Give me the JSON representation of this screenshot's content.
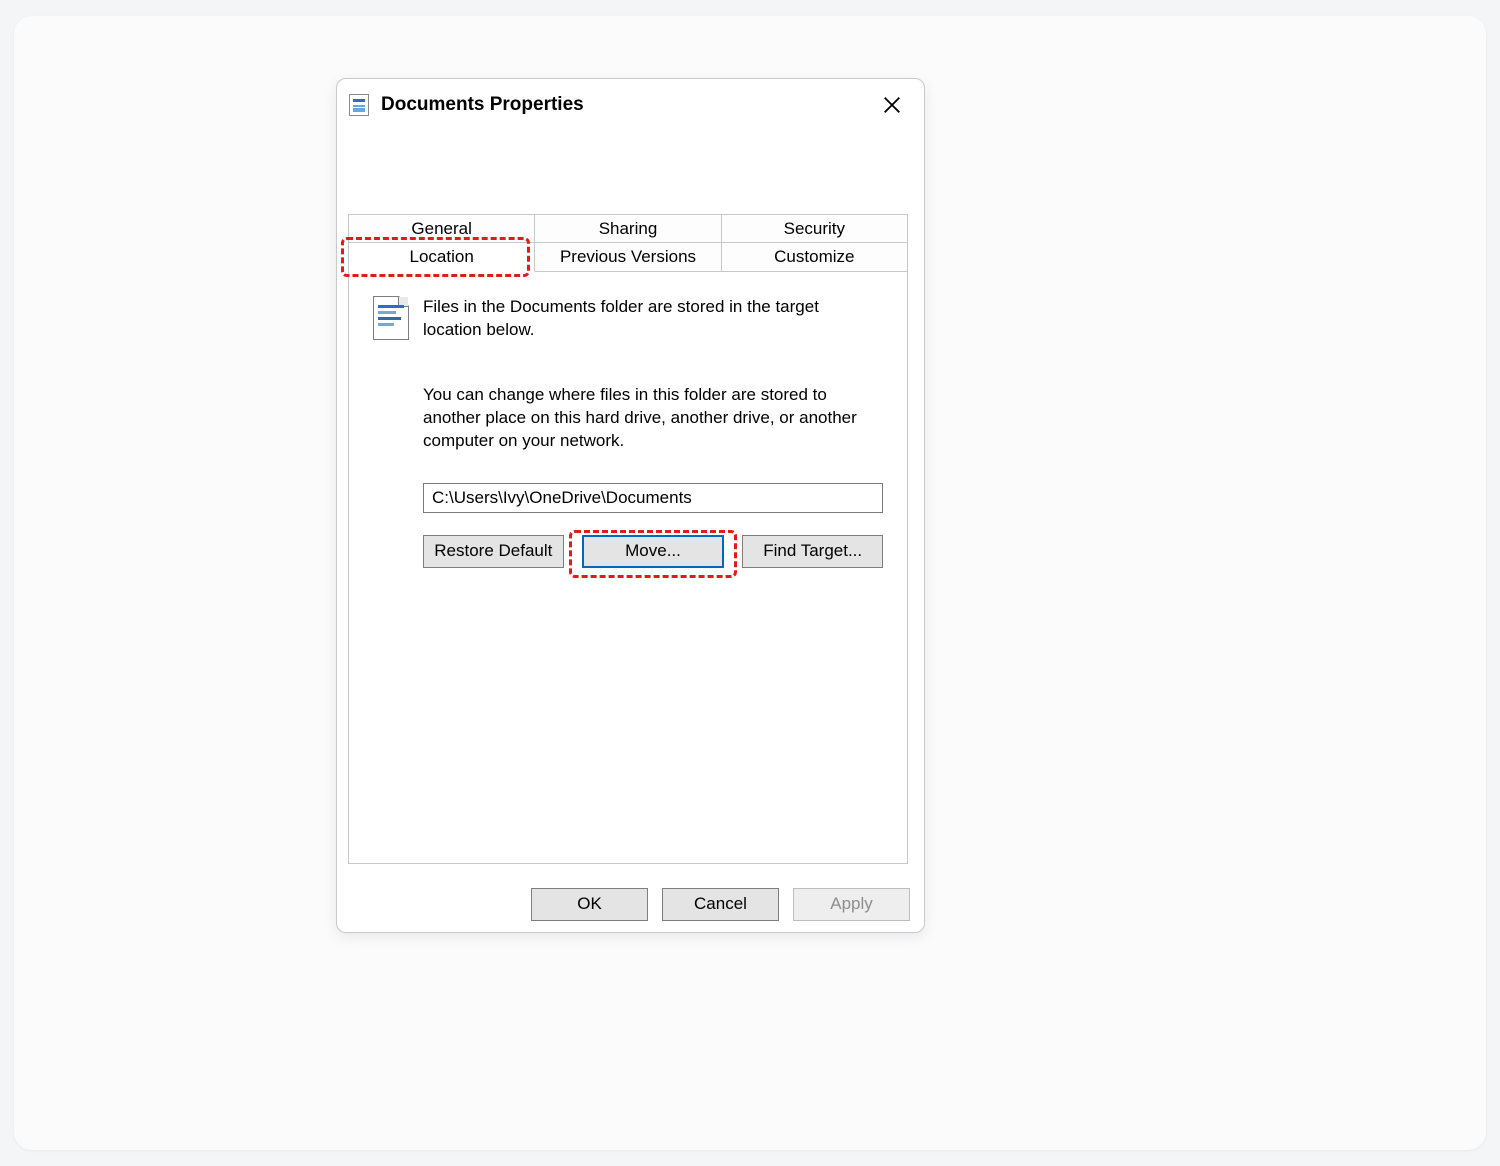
{
  "window": {
    "title": "Documents Properties"
  },
  "tabs": {
    "row1": [
      "General",
      "Sharing",
      "Security"
    ],
    "row2": [
      "Location",
      "Previous Versions",
      "Customize"
    ],
    "active": "Location"
  },
  "content": {
    "para1": "Files in the Documents folder are stored in the target location below.",
    "para2": "You can change where files in this folder are stored to another place on this hard drive, another drive, or another computer on your network.",
    "path": "C:\\Users\\Ivy\\OneDrive\\Documents",
    "buttons": {
      "restore": "Restore Default",
      "move": "Move...",
      "find": "Find Target..."
    }
  },
  "footer": {
    "ok": "OK",
    "cancel": "Cancel",
    "apply": "Apply"
  },
  "highlight": {
    "tab": "Location",
    "button": "Move..."
  }
}
